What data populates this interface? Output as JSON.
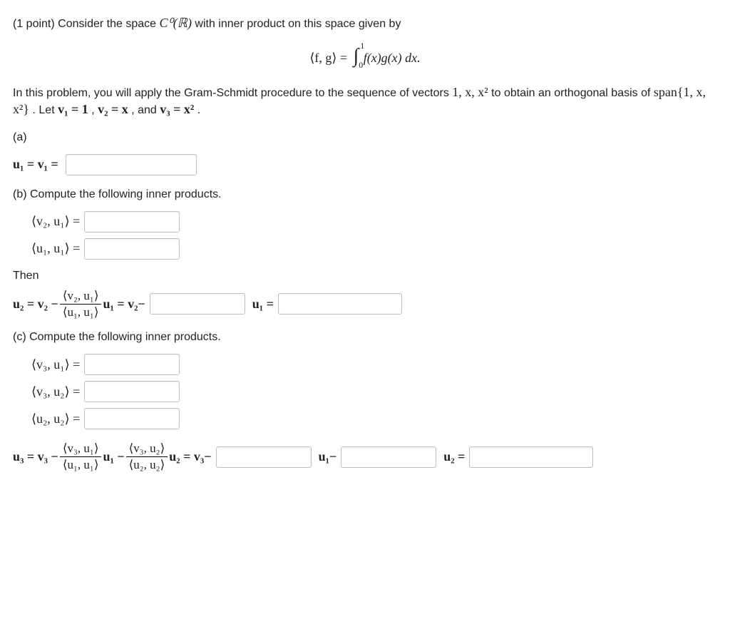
{
  "points": "(1 point)",
  "intro1": "Consider the space ",
  "space": "C⁰(ℝ)",
  "intro2": " with inner product on this space given by",
  "eq_lhs": "⟨f, g⟩ =",
  "eq_int_upper": "1",
  "eq_int_lower": "0",
  "eq_rhs": " f(x)g(x) dx.",
  "desc1": "In this problem, you will apply the Gram-Schmidt procedure to the sequence of vectors ",
  "seq": "1, x, x²",
  "desc2": " to obtain an orthogonal basis of ",
  "span": "span{1, x, x²}",
  "letdef": ". Let ",
  "v1": "v₁ = 1",
  "comma": ", ",
  "v2": "v₂ = x",
  "and": ", and ",
  "v3": "v₃ = x²",
  "period": ".",
  "a_label": "(a)",
  "a_expr": "u₁ = v₁ =",
  "b_label": "(b) Compute the following inner products.",
  "b1": "⟨v₂, u₁⟩ =",
  "b2": "⟨u₁, u₁⟩ =",
  "then": "Then",
  "u2_lead": "u₂ = v₂ −",
  "frac_b_num": "⟨v₂, u₁⟩",
  "frac_b_den": "⟨u₁, u₁⟩",
  "u1_tail": "u₁ = v₂−",
  "u1_sym": "u₁ =",
  "c_label": "(c) Compute the following inner products.",
  "c1": "⟨v₃, u₁⟩ =",
  "c2": "⟨v₃, u₂⟩ =",
  "c3": "⟨u₂, u₂⟩ =",
  "u3_lead": "u₃ = v₃ −",
  "frac_c1_num": "⟨v₃, u₁⟩",
  "frac_c1_den": "⟨u₁, u₁⟩",
  "mid_u1": "u₁ −",
  "frac_c2_num": "⟨v₃, u₂⟩",
  "frac_c2_den": "⟨u₂, u₂⟩",
  "u2_tail": "u₂ = v₃−",
  "u1_minus": "u₁−",
  "u2_eq": "u₂ ="
}
